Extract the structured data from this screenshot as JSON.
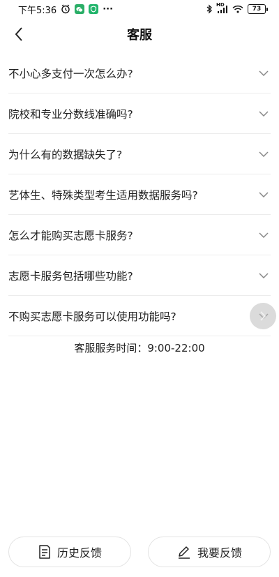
{
  "status_bar": {
    "time": "下午5:36",
    "more": "···",
    "signal_label": "HD",
    "battery": "73"
  },
  "header": {
    "title": "客服"
  },
  "faq": [
    {
      "question": "不小心多支付一次怎么办?"
    },
    {
      "question": "院校和专业分数线准确吗?"
    },
    {
      "question": "为什么有的数据缺失了?"
    },
    {
      "question": "艺体生、特殊类型考生适用数据服务吗?"
    },
    {
      "question": "怎么才能购买志愿卡服务?"
    },
    {
      "question": "志愿卡服务包括哪些功能?"
    },
    {
      "question": "不购买志愿卡服务可以使用功能吗?"
    }
  ],
  "service_hours": "客服服务时间：9:00-22:00",
  "bottom": {
    "history_label": "历史反馈",
    "feedback_label": "我要反馈"
  },
  "colors": {
    "wechat_green": "#2aae67",
    "shield_green": "#20b46a"
  }
}
